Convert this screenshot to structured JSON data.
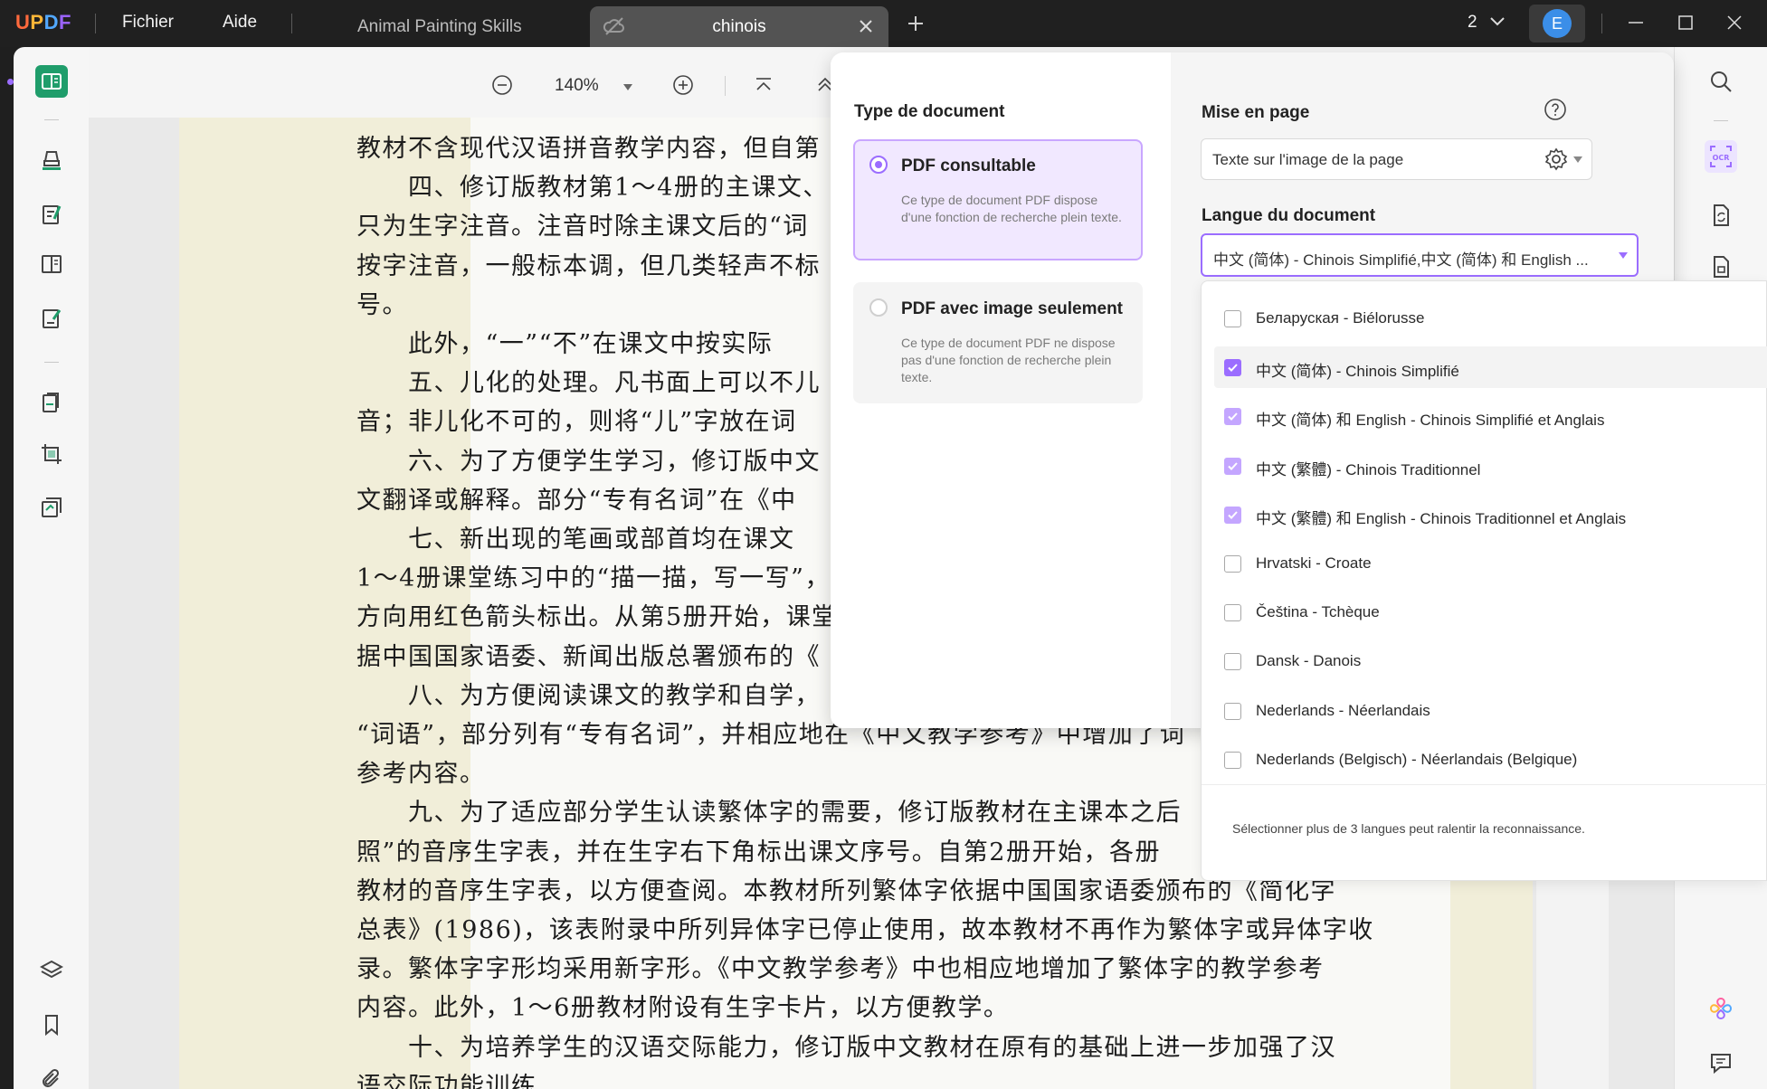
{
  "app": {
    "logo": "UPDF",
    "menu": [
      "Fichier",
      "Aide"
    ]
  },
  "tabs": [
    {
      "label": "Animal Painting Skills",
      "active": false
    },
    {
      "label": "chinois",
      "active": true
    }
  ],
  "window": {
    "page_count_indicator": "2",
    "avatar_initial": "E"
  },
  "viewer_toolbar": {
    "zoom": "140%"
  },
  "document": {
    "lines": [
      "教材不含现代汉语拼音教学内容，但自第",
      "　　四、修订版教材第1～4册的主课文、",
      "只为生字注音。注音时除主课文后的“词",
      "按字注音，一般标本调，但几类轻声不标",
      "号。",
      "　　此外，“一”“不”在课文中按实际",
      "　　五、儿化的处理。凡书面上可以不儿",
      "音；非儿化不可的，则将“儿”字放在词",
      "　　六、为了方便学生学习，修订版中文",
      "文翻译或解释。部分“专有名词”在《中",
      "　　七、新出现的笔画或部首均在课文",
      "1～4册课堂练习中的“描一描，写一写”，",
      "方向用红色箭头标出。从第5册开始，课堂",
      "据中国国家语委、新闻出版总署颁布的《",
      "　　八、为方便阅读课文的教学和自学，",
      "“词语”，部分列有“专有名词”，并相应地在《中文教学参考》中增加了词",
      "参考内容。",
      "　　九、为了适应部分学生认读繁体字的需要，修订版教材在主课本之后",
      "照”的音序生字表，并在生字右下角标出课文序号。自第2册开始，各册",
      "教材的音序生字表，以方便查阅。本教材所列繁体字依据中国国家语委颁布的《简化字",
      "总表》(1986)，该表附录中所列异体字已停止使用，故本教材不再作为繁体字或异体字收",
      "录。繁体字字形均采用新字形。《中文教学参考》中也相应地增加了繁体字的教学参考",
      "内容。此外，1～6册教材附设有生字卡片，以方便教学。",
      "　　十、为培养学生的汉语交际能力，修订版中文教材在原有的基础上进一步加强了汉",
      "语交际功能训练"
    ]
  },
  "ocr": {
    "doc_type_title": "Type de document",
    "options": [
      {
        "title": "PDF consultable",
        "desc": "Ce type de document PDF dispose d'une fonction de recherche plein texte.",
        "selected": true
      },
      {
        "title": "PDF avec image seulement",
        "desc": "Ce type de document PDF ne dispose pas d'une fonction de recherche plein texte.",
        "selected": false
      }
    ],
    "layout_title": "Mise en page",
    "layout_value": "Texte sur l'image de la page",
    "language_title": "Langue du document",
    "language_value": "中文 (简体) - Chinois Simplifié,中文 (简体) 和 English ...",
    "languages": [
      {
        "label": "Беларуская - Biélorusse",
        "checked": false
      },
      {
        "label": "中文 (简体) - Chinois Simplifié",
        "checked": true
      },
      {
        "label": "中文 (简体) 和 English - Chinois Simplifié et Anglais",
        "checked": true
      },
      {
        "label": "中文 (繁體) - Chinois Traditionnel",
        "checked": true
      },
      {
        "label": "中文 (繁體) 和 English - Chinois Traditionnel et Anglais",
        "checked": true
      },
      {
        "label": "Hrvatski - Croate",
        "checked": false
      },
      {
        "label": "Čeština - Tchèque",
        "checked": false
      },
      {
        "label": "Dansk - Danois",
        "checked": false
      },
      {
        "label": "Nederlands - Néerlandais",
        "checked": false
      },
      {
        "label": "Nederlands (Belgisch) - Néerlandais (Belgique)",
        "checked": false
      }
    ],
    "warning": "Sélectionner plus de 3 langues peut ralentir la reconnaissance."
  },
  "colors": {
    "accent": "#9b6dff",
    "titlebar": "#202020",
    "page_margin": "#f1eed9"
  }
}
